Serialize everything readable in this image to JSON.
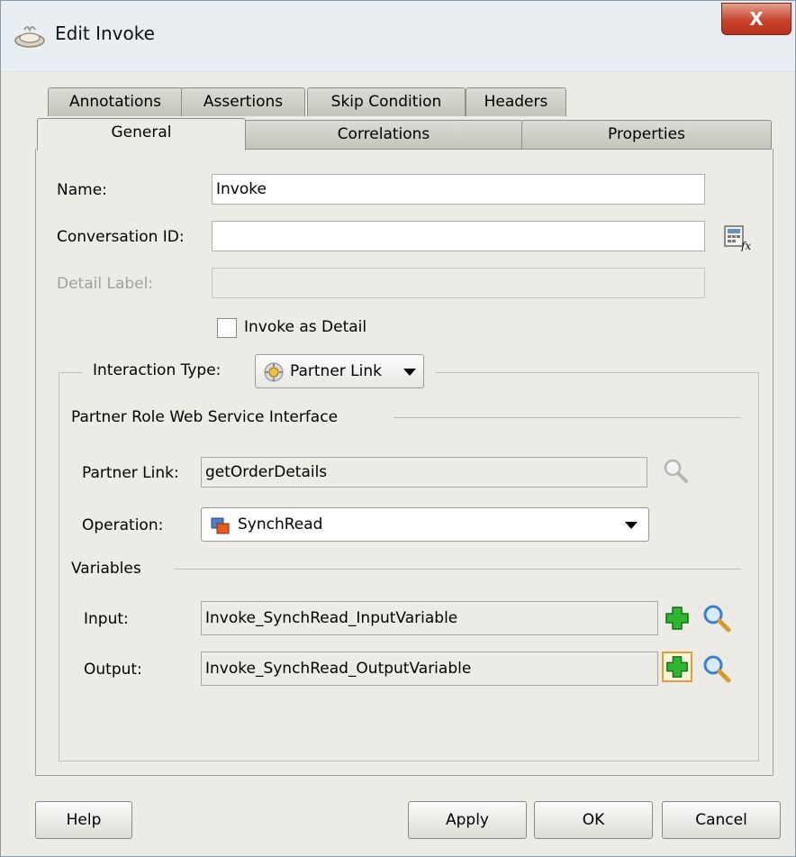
{
  "window": {
    "title": "Edit Invoke",
    "close_glyph": "X",
    "title_icon": "invoke-activity-icon"
  },
  "tabs": {
    "back_row": [
      "Annotations",
      "Assertions",
      "Skip Condition",
      "Headers"
    ],
    "front_row": [
      "General",
      "Correlations",
      "Properties"
    ],
    "active": "General"
  },
  "general": {
    "name_label": "Name:",
    "name_value": "Invoke",
    "conversation_label": "Conversation ID:",
    "conversation_value": "",
    "detail_label": "Detail Label:",
    "detail_value": "",
    "invoke_detail_label": "Invoke as Detail",
    "invoke_detail_checked": false,
    "interaction_label": "Interaction Type:",
    "interaction_value": "Partner Link",
    "partner_role_heading": "Partner Role Web Service Interface",
    "partner_link_label": "Partner Link:",
    "partner_link_value": "getOrderDetails",
    "operation_label": "Operation:",
    "operation_value": "SynchRead",
    "variables_heading": "Variables",
    "input_label": "Input:",
    "input_value": "Invoke_SynchRead_InputVariable",
    "output_label": "Output:",
    "output_value": "Invoke_SynchRead_OutputVariable"
  },
  "buttons": {
    "help": "Help",
    "apply": "Apply",
    "ok": "OK",
    "cancel": "Cancel"
  },
  "colors": {
    "dialog_bg": "#ecebe6",
    "close_red": "#c9442e",
    "add_green": "#2fb52f",
    "search_blue": "#3a7fd0"
  }
}
